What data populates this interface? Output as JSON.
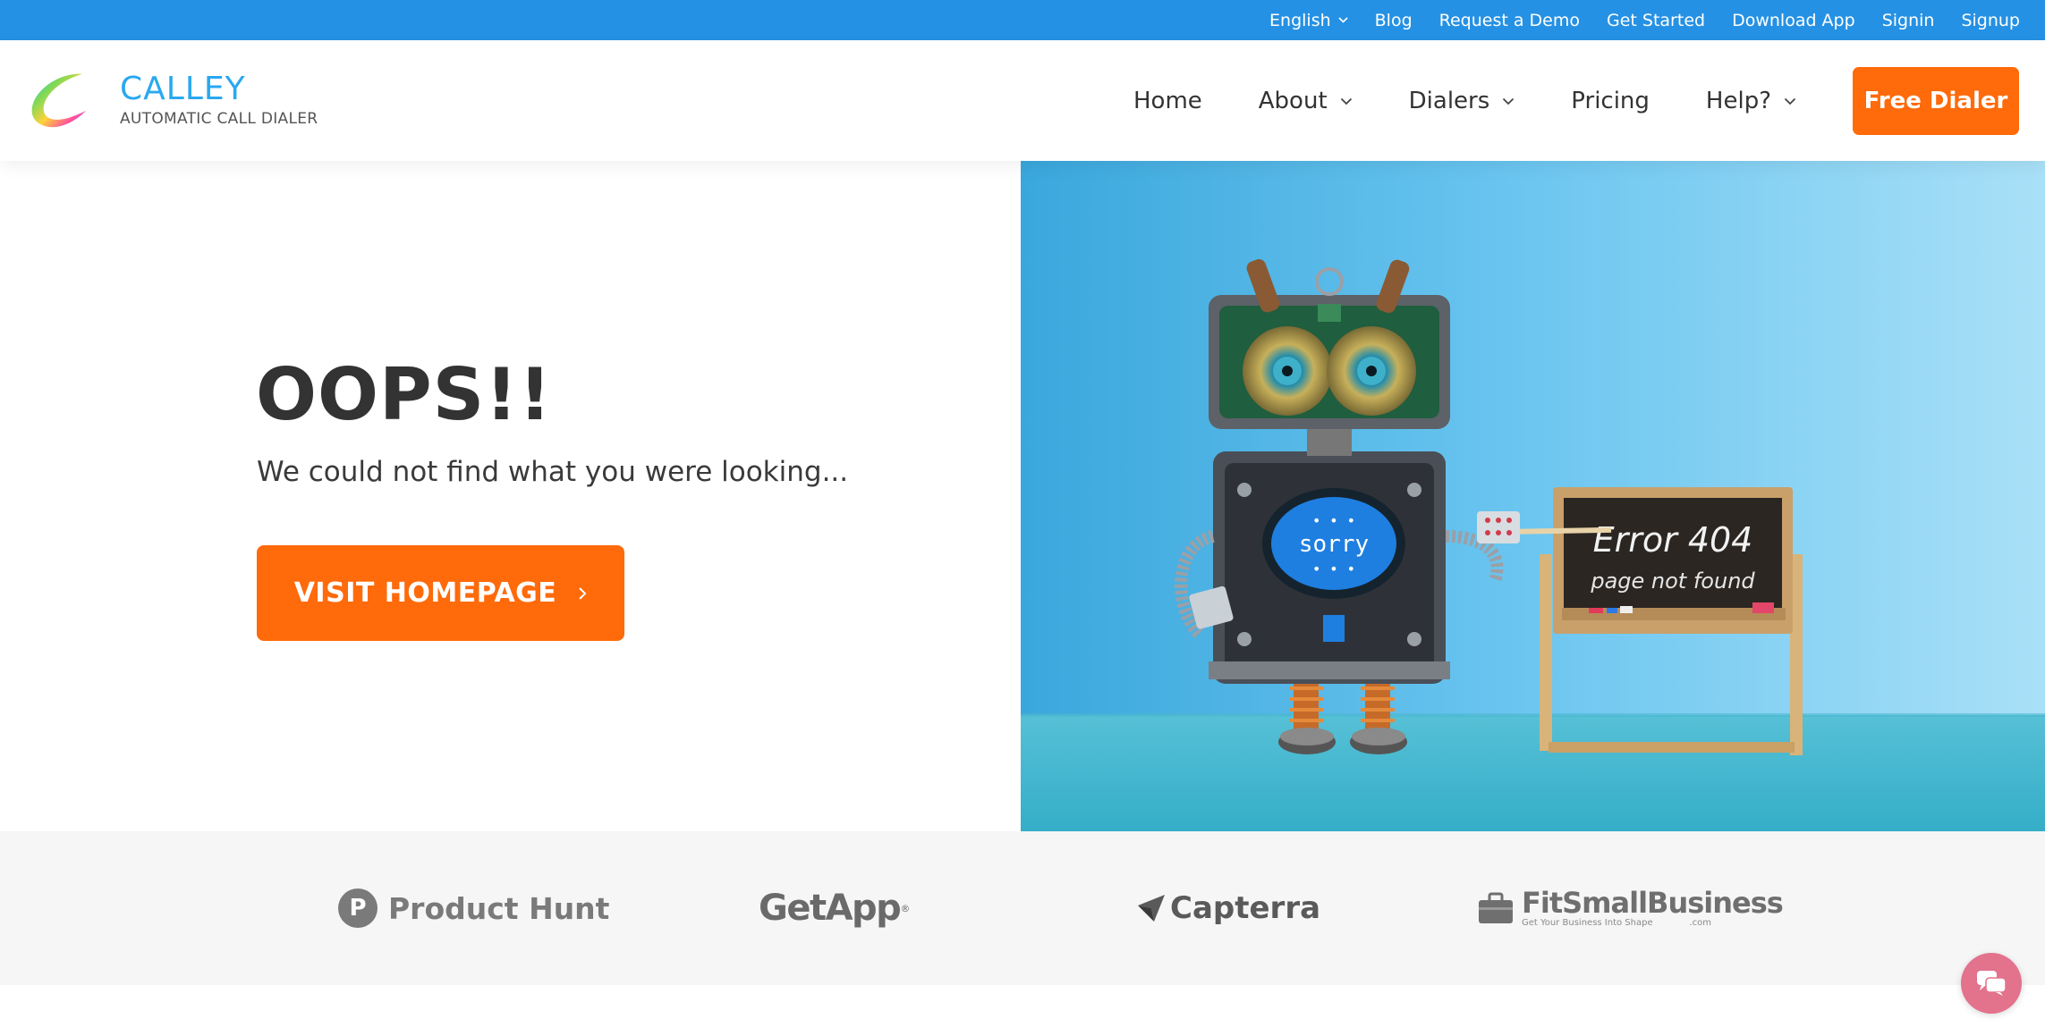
{
  "topbar": {
    "language": "English",
    "links": [
      "Blog",
      "Request a Demo",
      "Get Started",
      "Download App",
      "Signin",
      "Signup"
    ]
  },
  "header": {
    "brand_name": "CALLEY",
    "brand_tagline": "AUTOMATIC CALL DIALER",
    "nav": [
      {
        "label": "Home",
        "has_dropdown": false
      },
      {
        "label": "About",
        "has_dropdown": true
      },
      {
        "label": "Dialers",
        "has_dropdown": true
      },
      {
        "label": "Pricing",
        "has_dropdown": false
      },
      {
        "label": "Help?",
        "has_dropdown": true
      }
    ],
    "cta_label": "Free Dialer"
  },
  "hero": {
    "title": "OOPS!!",
    "subtitle": "We could not find what you were looking...",
    "button_label": "VISIT HOMEPAGE",
    "image": {
      "robot_screen_text": "sorry",
      "board_line1": "Error 404",
      "board_line2": "page not found"
    }
  },
  "brands": {
    "product_hunt": "Product Hunt",
    "product_hunt_letter": "P",
    "getapp": "GetApp",
    "capterra": "Capterra",
    "fitsmallbusiness": "FitSmallBusiness",
    "fitsmallbusiness_tagline": "Get Your Business Into Shape",
    "fitsmallbusiness_suffix": ".com"
  },
  "colors": {
    "topbar": "#2591e4",
    "accent": "#ff6a0a",
    "brand_blue": "#29a8f0",
    "chat": "#e3728c"
  },
  "icons": [
    "chevron-down-icon",
    "chevron-right-icon",
    "chat-icon",
    "capterra-arrow-icon",
    "calley-logo-icon"
  ]
}
